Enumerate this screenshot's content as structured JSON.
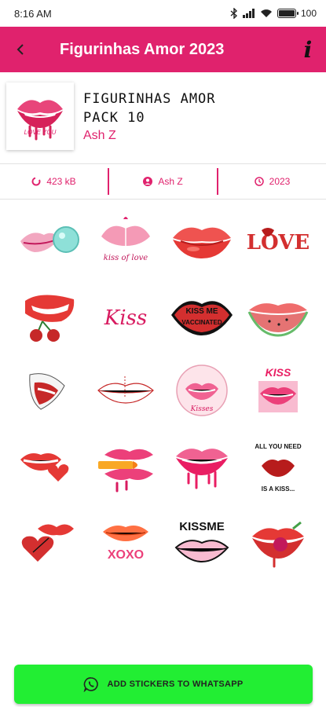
{
  "status_bar": {
    "time": "8:16 AM",
    "battery": "100",
    "battery_level": 1.0
  },
  "app_bar": {
    "title": "Figurinhas Amor 2023",
    "back_icon": "back-arrow-icon",
    "info_icon": "info-icon"
  },
  "pack": {
    "name": "Figurinhas Amor Pack 10",
    "publisher": "Ash Z"
  },
  "info": {
    "size": "423 kB",
    "author": "Ash Z",
    "year": "2023",
    "size_icon": "size-icon",
    "author_icon": "person-icon",
    "year_icon": "clock-icon"
  },
  "stickers_text": {
    "kiss_of_love": "kiss of love",
    "love": "LOVE",
    "kiss": "Kiss",
    "kiss_me": "KISS ME",
    "vaccinated": "VACCINATED",
    "kisses": "Kisses",
    "kiss_stack": "KISS",
    "all_you_need": "ALL YOU NEED",
    "is_a_kiss": "IS A KISS...",
    "xoxo": "XOXO",
    "kissme": "KISSME",
    "love_you": "LOVE YOU"
  },
  "cta": {
    "label": "ADD STICKERS TO WHATSAPP",
    "icon": "whatsapp-icon"
  },
  "colors": {
    "accent": "#e0226d",
    "cta": "#22ee33",
    "lip_red": "#e11b2b",
    "lip_pink": "#e8457a"
  }
}
